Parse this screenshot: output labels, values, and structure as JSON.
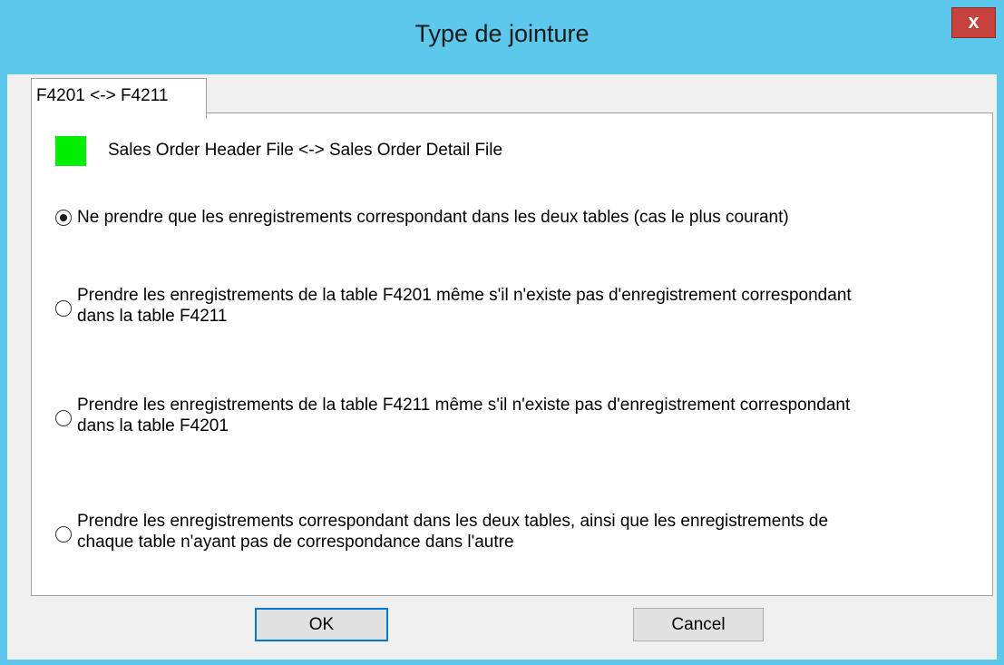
{
  "window": {
    "title": "Type de jointure",
    "close_label": "x"
  },
  "tab": {
    "label": "F4201 <-> F4211"
  },
  "relation": {
    "swatch_color": "#00ee00",
    "label": "Sales Order Header File <-> Sales Order Detail File"
  },
  "options": [
    {
      "checked": true,
      "lines": [
        "Ne prendre que les enregistrements correspondant dans les deux tables (cas le plus courant)"
      ]
    },
    {
      "checked": false,
      "lines": [
        "Prendre les enregistrements de la table F4201 même s'il n'existe pas d'enregistrement correspondant",
        "dans la table F4211"
      ]
    },
    {
      "checked": false,
      "lines": [
        "Prendre les enregistrements de la table F4211 même s'il n'existe pas d'enregistrement correspondant",
        "dans la table F4201"
      ]
    },
    {
      "checked": false,
      "lines": [
        "Prendre les enregistrements correspondant dans les deux tables, ainsi que les enregistrements de",
        "chaque table n'ayant pas de correspondance dans l'autre"
      ]
    }
  ],
  "buttons": {
    "ok_label": "OK",
    "cancel_label": "Cancel"
  }
}
